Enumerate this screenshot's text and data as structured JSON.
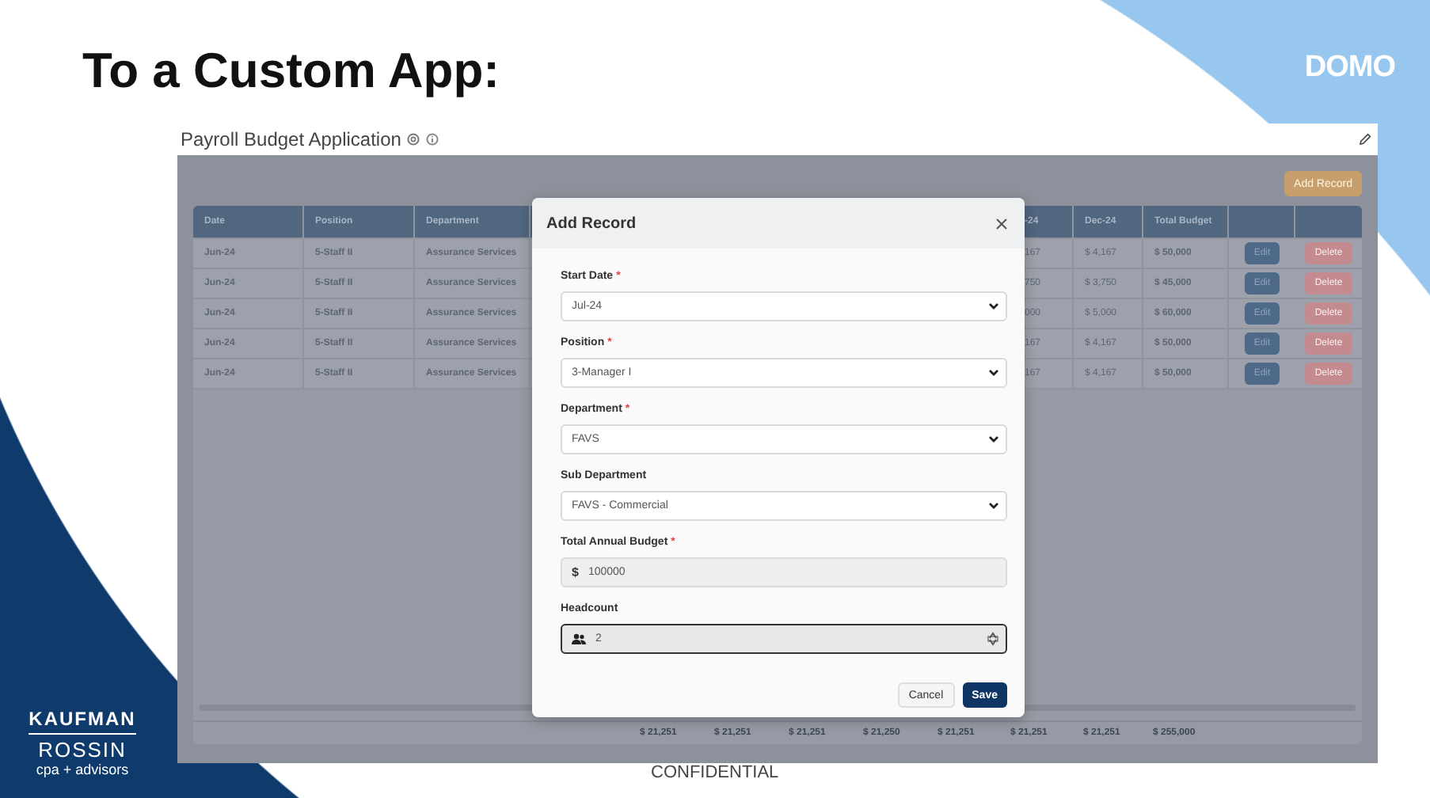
{
  "slide": {
    "title": "To a Custom App:",
    "logo_right": "DOMO",
    "logo_left": {
      "line_1": "KAUFMAN",
      "line_2": "ROSSIN",
      "line_3": "cpa + advisors"
    },
    "footer": "CONFIDENTIAL"
  },
  "app": {
    "title": "Payroll Budget Application",
    "add_button": "Add Record",
    "table": {
      "columns": [
        "Date",
        "Position",
        "Department",
        "-24",
        "Dec-24",
        "Total Budget"
      ],
      "rows": [
        {
          "cells": [
            "Jun-24",
            "5-Staff II",
            "Assurance Services",
            "167",
            "$ 4,167",
            "$ 50,000"
          ],
          "edit": "Edit",
          "delete": "Delete"
        },
        {
          "cells": [
            "Jun-24",
            "5-Staff II",
            "Assurance Services",
            "750",
            "$ 3,750",
            "$ 45,000"
          ],
          "edit": "Edit",
          "delete": "Delete"
        },
        {
          "cells": [
            "Jun-24",
            "5-Staff II",
            "Assurance Services",
            "000",
            "$ 5,000",
            "$ 60,000"
          ],
          "edit": "Edit",
          "delete": "Delete"
        },
        {
          "cells": [
            "Jun-24",
            "5-Staff II",
            "Assurance Services",
            "167",
            "$ 4,167",
            "$ 50,000"
          ],
          "edit": "Edit",
          "delete": "Delete"
        },
        {
          "cells": [
            "Jun-24",
            "5-Staff II",
            "Assurance Services",
            "167",
            "$ 4,167",
            "$ 50,000"
          ],
          "edit": "Edit",
          "delete": "Delete"
        }
      ],
      "totals": [
        "$ 21,251",
        "$ 21,251",
        "$ 21,251",
        "$ 21,250",
        "$ 21,251",
        "$ 21,251",
        "$ 21,251"
      ],
      "grand_total": "$ 255,000"
    }
  },
  "dialog": {
    "title": "Add Record",
    "fields": [
      {
        "label": "Start Date",
        "mark": "*",
        "kind": "select",
        "value": "Jul-24"
      },
      {
        "label": "Position",
        "mark": "*",
        "kind": "select",
        "value": "3-Manager I"
      },
      {
        "label": "Department",
        "mark": "*",
        "kind": "select",
        "value": "FAVS"
      },
      {
        "label": "Sub Department",
        "kind": "select",
        "value": "FAVS - Commercial"
      },
      {
        "label": "Total Annual Budget",
        "mark": "*",
        "kind": "currency",
        "prefix": "$",
        "value": "100000"
      },
      {
        "label": "Headcount",
        "kind": "people",
        "value": "2",
        "focused": true
      }
    ],
    "cancel": "Cancel",
    "save": "Save"
  }
}
